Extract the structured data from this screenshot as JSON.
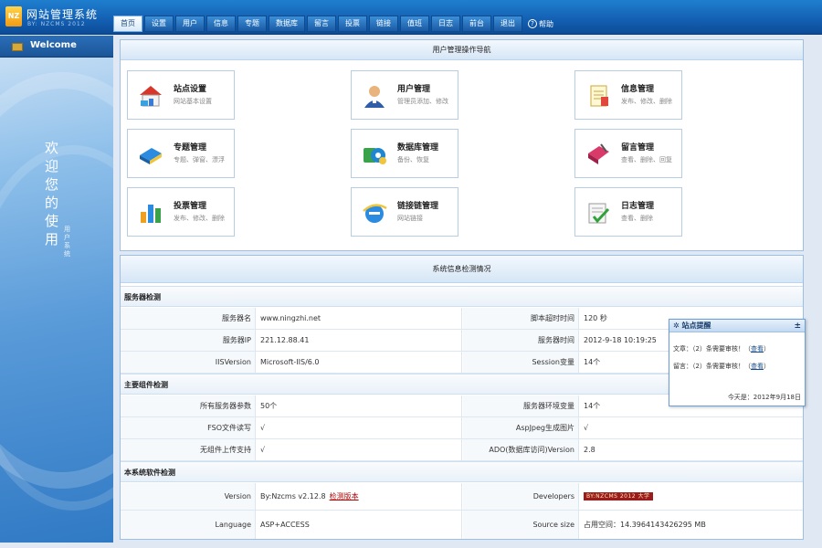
{
  "header": {
    "logo_text": "NZ",
    "title": "网站管理系统",
    "subtitle": "BY: NZCMS 2012",
    "nav": [
      "首页",
      "设置",
      "用户",
      "信息",
      "专题",
      "数据库",
      "留言",
      "投票",
      "链接",
      "值班",
      "日志",
      "前台",
      "退出"
    ],
    "help": "帮助"
  },
  "sidebar": {
    "welcome": "Welcome",
    "vertical_text": "欢迎您的使用",
    "vertical_sub": "用户系统"
  },
  "nav_panel": {
    "title": "用户管理操作导航",
    "cards": [
      {
        "title": "站点设置",
        "desc": "网站基本设置",
        "icon": "house-icon"
      },
      {
        "title": "用户管理",
        "desc": "管理员添加、修改",
        "icon": "user-icon"
      },
      {
        "title": "信息管理",
        "desc": "发布、修改、删除",
        "icon": "document-icon"
      },
      {
        "title": "专题管理",
        "desc": "专题、弹窗、漂浮",
        "icon": "books-icon"
      },
      {
        "title": "数据库管理",
        "desc": "备份、恢复",
        "icon": "database-icon"
      },
      {
        "title": "留言管理",
        "desc": "查看、删除、回复",
        "icon": "notebook-icon"
      },
      {
        "title": "投票管理",
        "desc": "发布、修改、删除",
        "icon": "bar-chart-icon"
      },
      {
        "title": "链接链管理",
        "desc": "网站链接",
        "icon": "ie-icon"
      },
      {
        "title": "日志管理",
        "desc": "查看、删除",
        "icon": "checklist-icon"
      }
    ]
  },
  "sys_panel": {
    "title": "系统信息检测情况",
    "sections": {
      "server": "服务器检测",
      "components": "主要组件检测",
      "software": "本系统软件检测"
    },
    "server_rows": [
      [
        "服务器名",
        "www.ningzhi.net",
        "脚本超时时间",
        "120 秒"
      ],
      [
        "服务器IP",
        "221.12.88.41",
        "服务器时间",
        "2012-9-18 10:19:25"
      ],
      [
        "IISVersion",
        "Microsoft-IIS/6.0",
        "Session变量",
        "14个"
      ]
    ],
    "component_rows": [
      [
        "所有服务器参数",
        "50个",
        "服务器环境变量",
        "14个"
      ],
      [
        "FSO文件读写",
        "√",
        "AspJpeg生成图片",
        "√"
      ],
      [
        "无组件上传支持",
        "√",
        "ADO(数据库访问)Version",
        "2.8"
      ]
    ],
    "software_rows": {
      "version_label": "Version",
      "version_value": "By:Nzcms v2.12.8",
      "version_link": "检测版本",
      "developers_label": "Developers",
      "developers_badge": "BY:NZCMS 2012 大学",
      "language_label": "Language",
      "language_value": "ASP+ACCESS",
      "size_label": "Source size",
      "size_value": "占用空间：14.3964143426295 MB"
    }
  },
  "popup": {
    "title": "站点提醒",
    "close": "±",
    "line1_pre": "文章：（",
    "line1_count": "2",
    "line1_mid": "）条需要审核！（",
    "line1_link": "查看",
    "line1_post": "）",
    "line2_pre": "留言：（",
    "line2_count": "2",
    "line2_mid": "）条需要审核！（",
    "line2_link": "查看",
    "line2_post": "）",
    "date": "今天是：2012年9月18日"
  }
}
